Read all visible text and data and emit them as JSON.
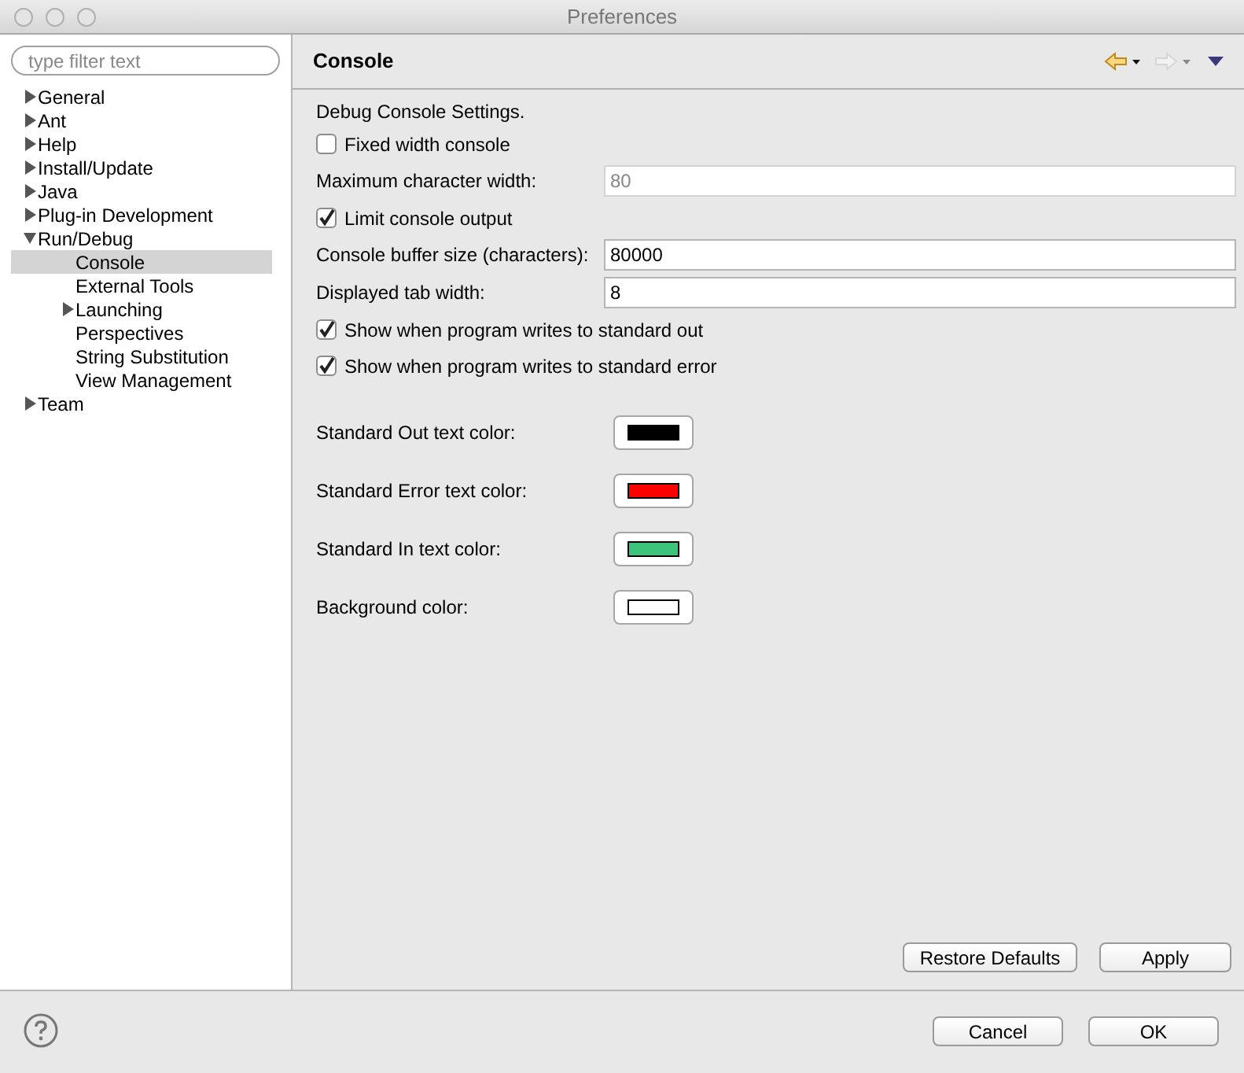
{
  "window": {
    "title": "Preferences"
  },
  "filter": {
    "placeholder": "type filter text"
  },
  "tree": [
    {
      "label": "General",
      "expanded": false,
      "selected": false
    },
    {
      "label": "Ant",
      "expanded": false,
      "selected": false
    },
    {
      "label": "Help",
      "expanded": false,
      "selected": false
    },
    {
      "label": "Install/Update",
      "expanded": false,
      "selected": false
    },
    {
      "label": "Java",
      "expanded": false,
      "selected": false
    },
    {
      "label": "Plug-in Development",
      "expanded": false,
      "selected": false
    },
    {
      "label": "Run/Debug",
      "expanded": true,
      "selected": false,
      "children": [
        {
          "label": "Console",
          "selected": true
        },
        {
          "label": "External Tools",
          "selected": false
        },
        {
          "label": "Launching",
          "expanded": false,
          "selected": false
        },
        {
          "label": "Perspectives",
          "selected": false
        },
        {
          "label": "String Substitution",
          "selected": false
        },
        {
          "label": "View Management",
          "selected": false
        }
      ]
    },
    {
      "label": "Team",
      "expanded": false,
      "selected": false
    }
  ],
  "page": {
    "title": "Console",
    "settings": [
      {
        "kind": "text",
        "label": "Debug Console Settings."
      },
      {
        "kind": "checkbox",
        "label": "Fixed width console",
        "checked": false
      },
      {
        "kind": "field",
        "label": "Maximum character width:",
        "value": "80",
        "disabled": true
      },
      {
        "kind": "checkbox",
        "label": "Limit console output",
        "checked": true
      },
      {
        "kind": "field",
        "label": "Console buffer size (characters):",
        "value": "80000",
        "disabled": false
      },
      {
        "kind": "field",
        "label": "Displayed tab width:",
        "value": "8",
        "disabled": false
      },
      {
        "kind": "checkbox",
        "label": "Show when program writes to standard out",
        "checked": true
      },
      {
        "kind": "checkbox",
        "label": "Show when program writes to standard error",
        "checked": true
      },
      {
        "kind": "color",
        "label": "Standard Out text color:",
        "color": "#000000"
      },
      {
        "kind": "color",
        "label": "Standard Error text color:",
        "color": "#ff0000"
      },
      {
        "kind": "color",
        "label": "Standard In text color:",
        "color": "#3cc47a"
      },
      {
        "kind": "color",
        "label": "Background color:",
        "color": "#ffffff"
      }
    ],
    "buttons": [
      "Restore Defaults",
      "Apply"
    ]
  },
  "footer_buttons": [
    "Cancel",
    "OK"
  ]
}
